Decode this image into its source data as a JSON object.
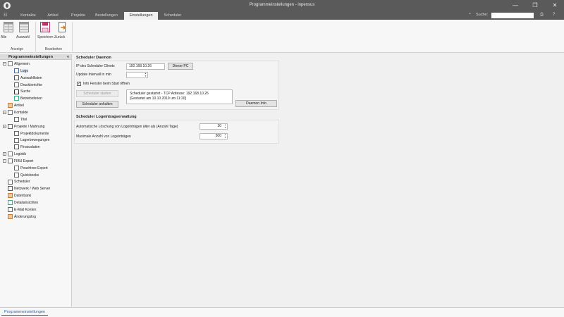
{
  "window": {
    "title": "Programmeinstellungen - inpensus",
    "min_glyph": "—",
    "max_glyph": "❐",
    "close_glyph": "✕"
  },
  "menu": {
    "tabs": [
      "Kontakte",
      "Artikel",
      "Projekte",
      "Bestellungen",
      "Einstellungen",
      "Scheduler"
    ],
    "active_tab": "Einstellungen",
    "search_label": "Suche:",
    "search_placeholder": ""
  },
  "ribbon": {
    "groups": [
      {
        "label": "Anzeige",
        "buttons": [
          {
            "label": "Alle",
            "icon": "grid-icon"
          },
          {
            "label": "Auswahl",
            "icon": "list-icon"
          }
        ]
      },
      {
        "label": "Bearbeiten",
        "buttons": [
          {
            "label": "Speichern",
            "icon": "save-icon"
          },
          {
            "label": "Zurück",
            "icon": "undo-icon"
          }
        ]
      }
    ]
  },
  "sidebar": {
    "title": "Programmeinstellungen",
    "collapse": "«",
    "items": [
      {
        "label": "Allgemein",
        "level": 0,
        "toggle": "−",
        "icon": "settings-icon"
      },
      {
        "label": "Logo",
        "level": 1,
        "icon": "image-icon",
        "selected": true
      },
      {
        "label": "Auswahllisten",
        "level": 1,
        "icon": "list-icon"
      },
      {
        "label": "Druckberichte",
        "level": 1,
        "icon": "printer-icon"
      },
      {
        "label": "Suche",
        "level": 1,
        "icon": "binoculars-icon"
      },
      {
        "label": "Betriebsferien",
        "level": 1,
        "icon": "vacation-icon"
      },
      {
        "label": "Artikel",
        "level": 0,
        "icon": "box-icon"
      },
      {
        "label": "Kontakte",
        "level": 0,
        "toggle": "−",
        "icon": "contacts-icon"
      },
      {
        "label": "Titel",
        "level": 1,
        "icon": "user-icon"
      },
      {
        "label": "Projekte / Mahnung",
        "level": 0,
        "toggle": "−",
        "icon": "document-icon"
      },
      {
        "label": "Projektdokumente",
        "level": 1,
        "icon": "document-icon"
      },
      {
        "label": "Lagerbewegungen",
        "level": 1,
        "icon": "document-icon"
      },
      {
        "label": "Finanzdaten",
        "level": 1,
        "icon": "finance-icon"
      },
      {
        "label": "Logistik",
        "level": 0,
        "toggle": "+",
        "icon": "truck-icon"
      },
      {
        "label": "FIBU Export",
        "level": 0,
        "toggle": "−",
        "icon": "export-icon"
      },
      {
        "label": "Peachtree Export",
        "level": 1,
        "icon": "document-icon"
      },
      {
        "label": "Quickbooks",
        "level": 1,
        "icon": "document-icon"
      },
      {
        "label": "Scheduler",
        "level": 0,
        "icon": "clock-icon"
      },
      {
        "label": "Netzwerk / Web Server",
        "level": 0,
        "icon": "network-icon"
      },
      {
        "label": "Datenbank",
        "level": 0,
        "icon": "database-icon"
      },
      {
        "label": "Detailansichten",
        "level": 0,
        "icon": "grid-icon"
      },
      {
        "label": "E-Mail Konten",
        "level": 0,
        "icon": "email-icon"
      },
      {
        "label": "Änderungslog",
        "level": 0,
        "icon": "log-icon"
      }
    ]
  },
  "daemon": {
    "title": "Scheduler Daemon",
    "ip_label": "IP des Scheduler Clients",
    "ip_value": "192.168.10.26",
    "this_pc_button": "Dieser PC",
    "interval_label": "Update Intervall in min",
    "interval_value": "",
    "info_checkbox_label": "Info Fenster beim Start öffnen",
    "info_checked": true,
    "start_button": "Scheduler starten",
    "stop_button": "Scheduler anhalten",
    "status_line1": "Scheduler gestartet - TCP Adresse: 192.168.10.26",
    "status_line2": "[Gestartet am 10.10.2019 um 11:20]",
    "daemon_info_button": "Daemon Info"
  },
  "log": {
    "title": "Scheduler Logeintragverwaltung",
    "auto_delete_label": "Automatische Löschung von Logeinträgen älter als (Anzahl Tage)",
    "auto_delete_value": "30",
    "max_entries_label": "Maximale Anzahl von Logeinträgen",
    "max_entries_value": "500"
  },
  "bottom": {
    "tab_label": "Programmeinstellungen"
  },
  "colors": {
    "titlebar": "#5a5a5a",
    "accent": "#2b5ea8",
    "save_icon": "#c0306a"
  }
}
